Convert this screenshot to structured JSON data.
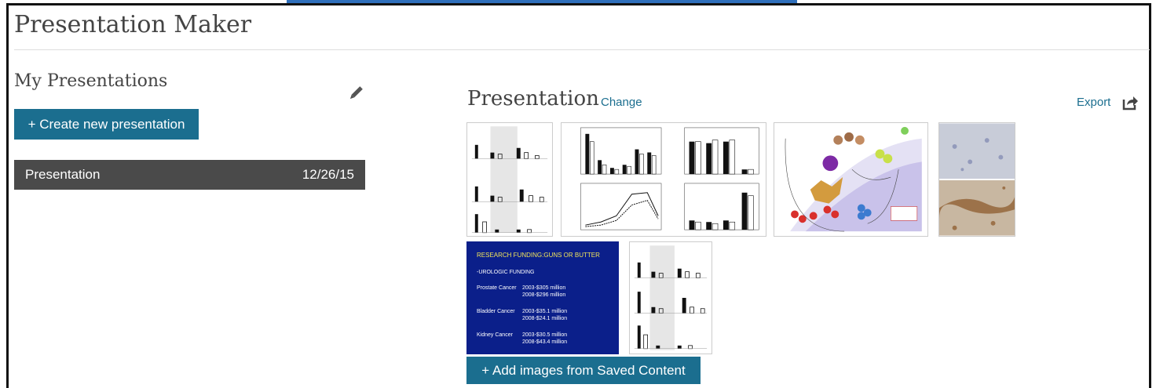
{
  "app": {
    "title": "Presentation Maker"
  },
  "sidebar": {
    "title": "My Presentations",
    "create_label": "+ Create new presentation",
    "items": [
      {
        "name": "Presentation",
        "date": "12/26/15"
      }
    ]
  },
  "main": {
    "heading": "Presentation",
    "change_label": "Change",
    "export_label": "Export",
    "add_label": "+ Add images from Saved Content",
    "slide": {
      "title": "RESEARCH FUNDING:GUNS OR BUTTER",
      "subtitle": "-UROLOGIC FUNDING",
      "rows": [
        {
          "label": "Prostate Cancer",
          "values": "2003-$305 million\n2008-$296 million"
        },
        {
          "label": "Bladder Cancer",
          "values": "2003-$35.1 million\n2008-$24.1 million"
        },
        {
          "label": "Kidney Cancer",
          "values": "2003-$30.5 million\n2008-$43.4 million"
        }
      ]
    }
  },
  "colors": {
    "accent": "#1b6e8f",
    "row_bg": "#4a4a4a",
    "tab": "#2f6fbb",
    "slide_bg": "#0b1f8a"
  },
  "icons": {
    "edit": "pencil-icon",
    "export": "share-arrow-icon"
  }
}
